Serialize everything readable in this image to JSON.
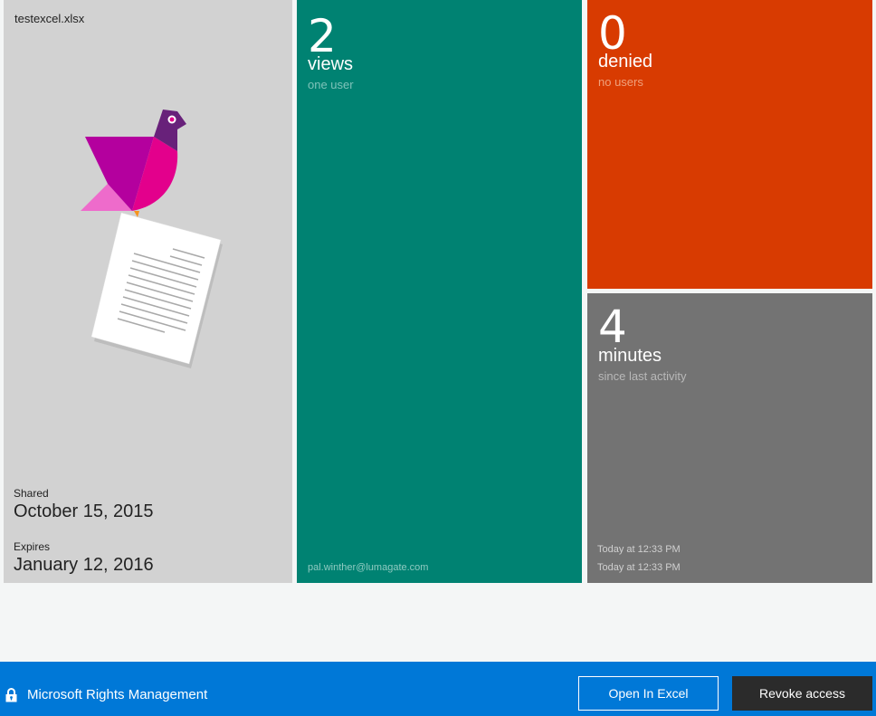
{
  "file": {
    "name": "testexcel.xlsx",
    "shared_label": "Shared",
    "shared_date": "October 15, 2015",
    "expires_label": "Expires",
    "expires_date": "January 12, 2016",
    "illustration": "bird-carrying-document"
  },
  "views": {
    "count": "2",
    "label": "views",
    "sub": "one user",
    "users": [
      "pal.winther@lumagate.com"
    ],
    "color": "#008272"
  },
  "denied": {
    "count": "0",
    "label": "denied",
    "sub": "no users",
    "color": "#d83b01"
  },
  "minutes": {
    "count": "4",
    "label": "minutes",
    "sub": "since last activity",
    "activity": [
      "Today at 12:33 PM",
      "Today at 12:33 PM"
    ],
    "color": "#737373"
  },
  "bottom_bar": {
    "brand_label": "Microsoft Rights Management",
    "brand_icon": "lock-icon",
    "open_button": "Open In Excel",
    "revoke_button": "Revoke access",
    "color": "#0078d7"
  }
}
